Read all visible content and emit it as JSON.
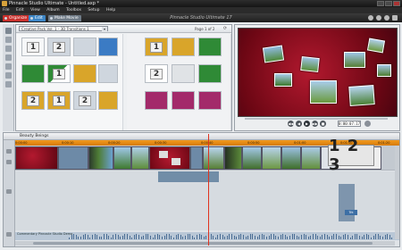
{
  "window": {
    "title": "Pinnacle Studio Ultimate - Untitled.axp *",
    "app_title": "Pinnacle Studio Ultimate 17"
  },
  "menu": [
    "File",
    "Edit",
    "View",
    "Album",
    "Toolbox",
    "Setup",
    "Help"
  ],
  "tabs": [
    {
      "label": "Organize",
      "color": "#c9302c"
    },
    {
      "label": "Edit",
      "color": "#3d86c6"
    },
    {
      "label": "Make Movie",
      "color": "#6f7b87"
    }
  ],
  "library": {
    "dropdown_value": "Creative Pack Vol. 1 - 3D Transitions 1",
    "page_info": "Page 1 of 2",
    "left_section": [
      {
        "label": "1",
        "bg": "#3b7bc4"
      },
      {
        "label": "2",
        "bg": "#cfd6de"
      },
      {
        "label": "",
        "bg": "#cfd6de"
      },
      {
        "label": "",
        "bg": "#2f8a36"
      },
      {
        "label": "1",
        "bg": "#ffffff"
      },
      {
        "label": "",
        "bg": "#d9a52a"
      },
      {
        "label": "2",
        "bg": "#d9a52a"
      },
      {
        "label": "1",
        "bg": "#d9a52a"
      },
      {
        "label": "2",
        "bg": "#cfd6de"
      }
    ],
    "right_section": [
      {
        "label": "1",
        "bg": "#d9a52a"
      },
      {
        "label": "",
        "bg": "#d9a52a"
      },
      {
        "label": "",
        "bg": "#2f8a36"
      },
      {
        "label": "2",
        "bg": "#ffffff"
      },
      {
        "label": "",
        "bg": "#e0e3e6"
      },
      {
        "label": "",
        "bg": "#2f8a36"
      },
      {
        "label": "",
        "bg": "#a32a6a"
      },
      {
        "label": "",
        "bg": "#a32a6a"
      },
      {
        "label": "",
        "bg": "#a32a6a"
      }
    ]
  },
  "preview": {
    "timecode": "0:00:07:17",
    "transport": [
      "◀◀",
      "◀",
      "▶",
      "▶▶",
      "■"
    ]
  },
  "timeline": {
    "project_name": "Beauty Beings",
    "ruler_ticks": [
      "0:00:00",
      "0:00:10",
      "0:00:20",
      "0:00:30",
      "0:00:40",
      "0:00:50",
      "0:01:00",
      "0:01:10",
      "0:01:20"
    ],
    "overlay_text": "1 2 3",
    "box_label": "Trk",
    "audio_label": "Commentary Pinnacle Studio Demo"
  }
}
